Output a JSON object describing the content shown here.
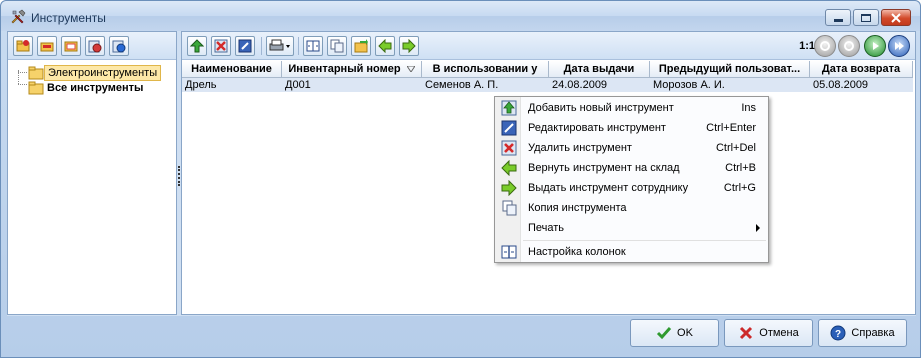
{
  "window": {
    "title": "Инструменты",
    "icon": "tools-icon"
  },
  "tree": {
    "items": [
      {
        "label": "Электроинструменты",
        "selected": true
      },
      {
        "label": "Все инструменты",
        "bold": true
      }
    ]
  },
  "toolbar": {
    "zoom_label": "1:1"
  },
  "grid": {
    "columns": [
      "Наименование",
      "Инвентарный номер",
      "В использовании у",
      "Дата выдачи",
      "Предыдущий пользоват...",
      "Дата возврата"
    ],
    "rows": [
      [
        "Дрель",
        "Д001",
        "Семенов А. П.",
        "24.08.2009",
        "Морозов А. И.",
        "05.08.2009"
      ]
    ]
  },
  "context_menu": {
    "items": [
      {
        "label": "Добавить новый инструмент",
        "shortcut": "Ins",
        "icon": "add-up-arrow-icon"
      },
      {
        "label": "Редактировать инструмент",
        "shortcut": "Ctrl+Enter",
        "icon": "edit-icon"
      },
      {
        "label": "Удалить инструмент",
        "shortcut": "Ctrl+Del",
        "icon": "delete-icon"
      },
      {
        "label": "Вернуть инструмент на склад",
        "shortcut": "Ctrl+B",
        "icon": "arrow-left-icon"
      },
      {
        "label": "Выдать инструмент сотруднику",
        "shortcut": "Ctrl+G",
        "icon": "arrow-right-icon"
      },
      {
        "label": "Копия инструмента",
        "shortcut": "",
        "icon": "copy-icon"
      },
      {
        "label": "Печать",
        "shortcut": "",
        "icon": "",
        "submenu": true
      },
      {
        "label": "Настройка колонок",
        "shortcut": "",
        "icon": "columns-icon"
      }
    ]
  },
  "buttons": {
    "ok": "OK",
    "cancel": "Отмена",
    "help": "Справка"
  },
  "colors": {
    "selection": "#dce6f4",
    "tree_selected": "#fde8a8",
    "accent_green": "#2f9a2f",
    "accent_red": "#cc2a2a"
  }
}
